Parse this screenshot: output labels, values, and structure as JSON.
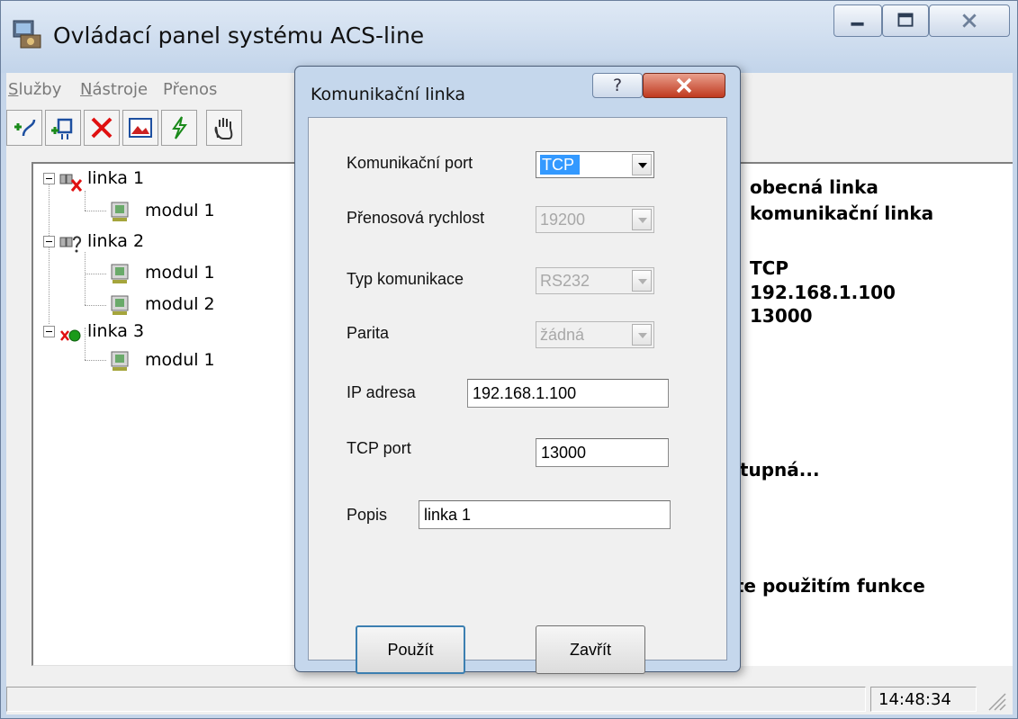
{
  "window": {
    "title": "Ovládací panel systému ACS-line"
  },
  "menu": [
    {
      "label_first": "S",
      "label_rest": "lužby"
    },
    {
      "label_first": "N",
      "label_rest": "ástroje"
    },
    {
      "label_first": "",
      "label_rest": "Přenos"
    }
  ],
  "toolbar": {
    "icons": [
      "add-line-icon",
      "add-module-icon",
      "delete-icon",
      "picture-icon",
      "lightning-icon",
      "hand-icon"
    ]
  },
  "tree": [
    {
      "label": "linka 1",
      "icon": "line-disconnected-icon"
    },
    {
      "label": "modul 1",
      "icon": "module-icon"
    },
    {
      "label": "linka 2",
      "icon": "line-unknown-icon"
    },
    {
      "label": "modul 1",
      "icon": "module-icon"
    },
    {
      "label": "modul 2",
      "icon": "module-icon"
    },
    {
      "label": "linka 3",
      "icon": "line-connected-icon"
    },
    {
      "label": "modul 1",
      "icon": "module-icon"
    }
  ],
  "detail": {
    "line1": "obecná linka",
    "line2": "komunikační linka",
    "protocol": "TCP",
    "ip": "192.168.1.100",
    "port": "13000",
    "status": "stupná...",
    "hint": "íte použitím funkce"
  },
  "status": {
    "time": "14:48:34"
  },
  "dialog": {
    "title": "Komunikační linka",
    "help": "?",
    "fields": {
      "port_label": "Komunikační port",
      "port_value": "TCP",
      "speed_label": "Přenosová rychlost",
      "speed_value": "19200",
      "type_label": "Typ komunikace",
      "type_value": "RS232",
      "parity_label": "Parita",
      "parity_value": "žádná",
      "ip_label": "IP adresa",
      "ip_value": "192.168.1.100",
      "tcp_label": "TCP port",
      "tcp_value": "13000",
      "desc_label": "Popis",
      "desc_value": "linka 1"
    },
    "buttons": {
      "apply": "Použít",
      "close": "Zavřít"
    }
  }
}
